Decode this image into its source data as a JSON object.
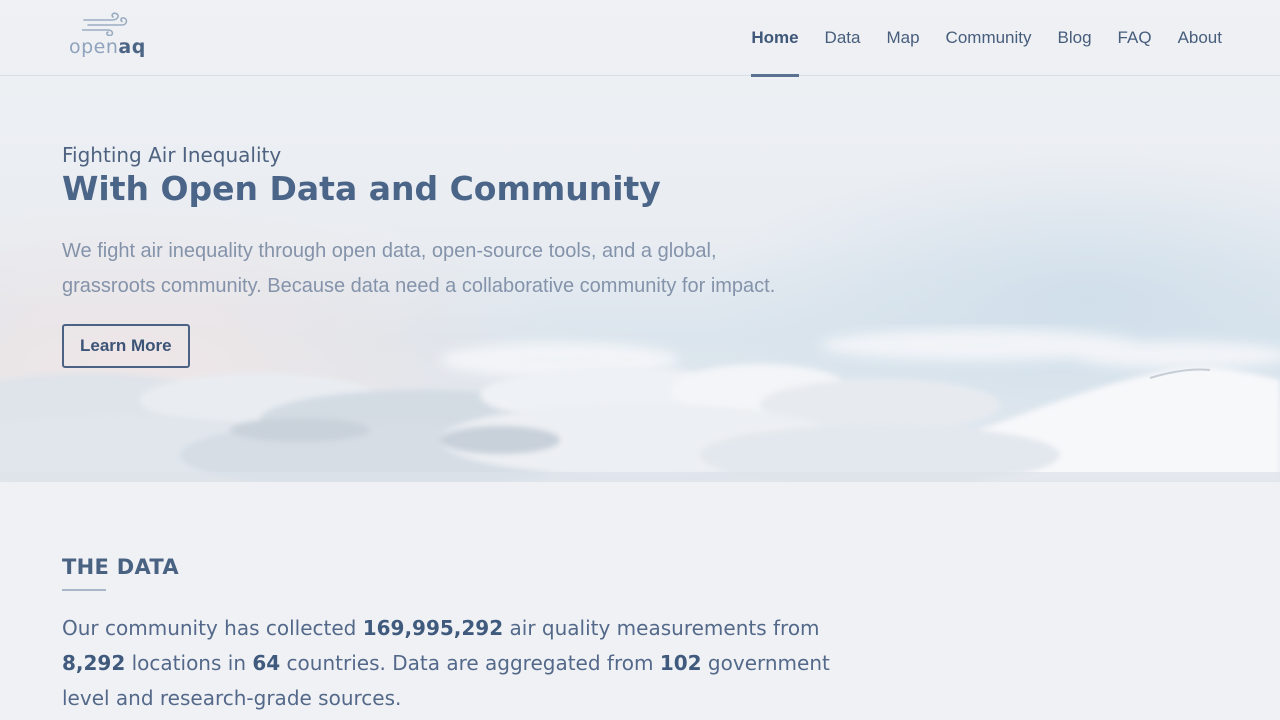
{
  "brand": {
    "logo_prefix": "open",
    "logo_suffix": "aq"
  },
  "nav": {
    "items": [
      {
        "label": "Home",
        "active": true
      },
      {
        "label": "Data",
        "active": false
      },
      {
        "label": "Map",
        "active": false
      },
      {
        "label": "Community",
        "active": false
      },
      {
        "label": "Blog",
        "active": false
      },
      {
        "label": "FAQ",
        "active": false
      },
      {
        "label": "About",
        "active": false
      }
    ]
  },
  "hero": {
    "kicker": "Fighting Air Inequality",
    "title": "With Open Data and Community",
    "description": "We fight air inequality through open data, open-source tools, and a global, grassroots community. Because data need a collaborative community for impact.",
    "cta_label": "Learn More"
  },
  "data_section": {
    "title": "THE DATA",
    "text_1": "Our community has collected ",
    "measurements": "169,995,292",
    "text_2": " air quality measurements from ",
    "locations": "8,292",
    "text_3": " locations in ",
    "countries": "64",
    "text_4": " countries. Data are aggregated from ",
    "sources": "102",
    "text_5": " government level and research-grade sources."
  },
  "colors": {
    "accent": "#4a6588",
    "background": "#eff1f5",
    "body_text": "#8493aa"
  }
}
